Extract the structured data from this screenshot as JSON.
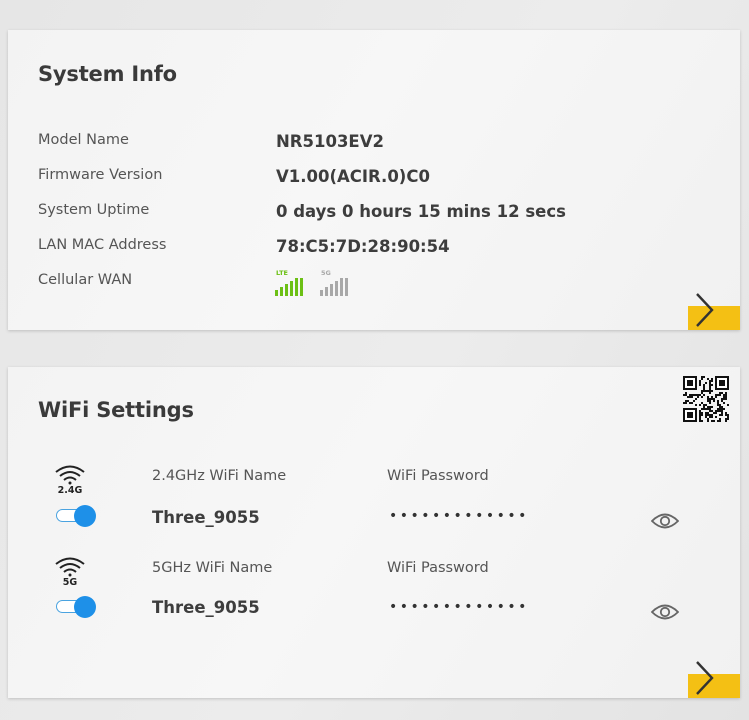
{
  "system_info": {
    "title": "System Info",
    "rows": [
      {
        "label": "Model Name",
        "value": "NR5103EV2"
      },
      {
        "label": "Firmware Version",
        "value": "V1.00(ACIR.0)C0"
      },
      {
        "label": "System Uptime",
        "value": "0 days 0 hours 15 mins 12 secs"
      },
      {
        "label": "LAN MAC Address",
        "value": "78:C5:7D:28:90:54"
      },
      {
        "label": "Cellular WAN",
        "value": ""
      }
    ],
    "cellular": {
      "lte": {
        "tag": "LTE",
        "color": "#6cc015",
        "icon": "signal-bars-icon",
        "active": true
      },
      "5g": {
        "tag": "5G",
        "color": "#a8a8a8",
        "icon": "signal-bars-icon",
        "active": false
      }
    }
  },
  "wifi_settings": {
    "title": "WiFi Settings",
    "networks": [
      {
        "band": "2.4G",
        "name_label": "2.4GHz WiFi Name",
        "name": "Three_9055",
        "password_label": "WiFi Password",
        "password_masked": "•••••••••••••",
        "enabled": true
      },
      {
        "band": "5G",
        "name_label": "5GHz WiFi Name",
        "name": "Three_9055",
        "password_label": "WiFi Password",
        "password_masked": "•••••••••••••",
        "enabled": true
      }
    ]
  },
  "colors": {
    "accent_yellow": "#f4c014",
    "toggle_blue": "#1e90e8",
    "lte_green": "#6cc015",
    "inactive_gray": "#a8a8a8"
  }
}
